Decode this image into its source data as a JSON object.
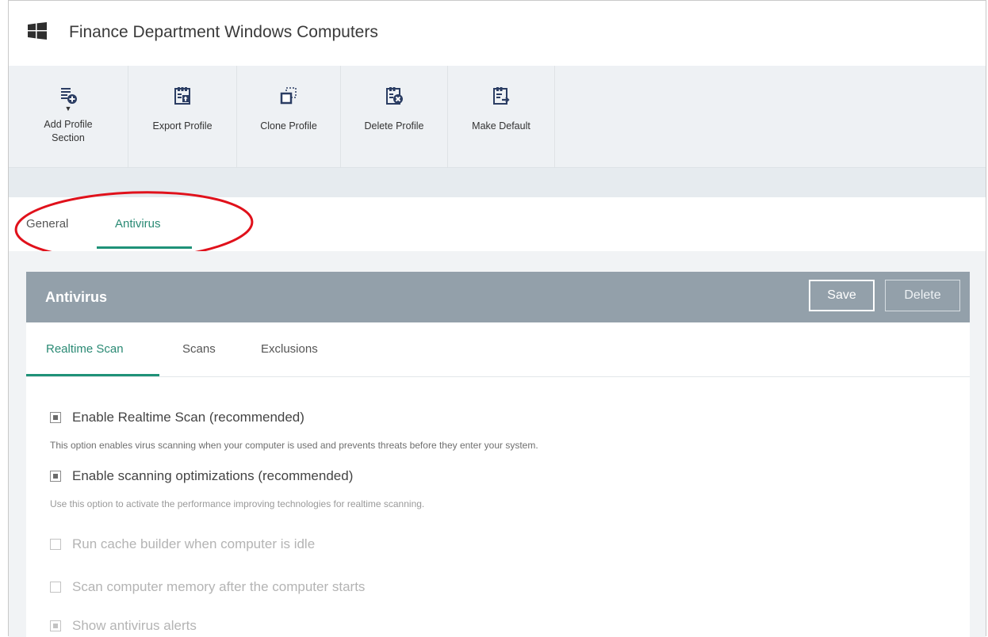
{
  "window": {
    "title": "Finance Department Windows Computers",
    "logo_icon": "windows-logo-icon"
  },
  "toolbar": {
    "items": [
      {
        "label": "Add Profile Section",
        "icon": "add-section-icon",
        "has_dropdown": true
      },
      {
        "label": "Export Profile",
        "icon": "export-icon"
      },
      {
        "label": "Clone Profile",
        "icon": "clone-icon"
      },
      {
        "label": "Delete Profile",
        "icon": "delete-profile-icon"
      },
      {
        "label": "Make Default",
        "icon": "make-default-icon"
      }
    ]
  },
  "top_tabs": [
    {
      "label": "General",
      "active": false
    },
    {
      "label": "Antivirus",
      "active": true
    }
  ],
  "panel": {
    "title": "Antivirus",
    "save_label": "Save",
    "delete_label": "Delete"
  },
  "sub_tabs": [
    {
      "label": "Realtime Scan",
      "active": true
    },
    {
      "label": "Scans",
      "active": false
    },
    {
      "label": "Exclusions",
      "active": false
    }
  ],
  "options": [
    {
      "label": "Enable Realtime Scan (recommended)",
      "checked": true,
      "enabled": true,
      "description": "This option enables virus scanning when your computer is used and prevents threats before they enter your system."
    },
    {
      "label": "Enable scanning optimizations (recommended)",
      "checked": true,
      "enabled": true,
      "description": "Use this option to activate the performance improving technologies for realtime scanning."
    },
    {
      "label": "Run cache builder when computer is idle",
      "checked": false,
      "enabled": false
    },
    {
      "label": "Scan computer memory after the computer starts",
      "checked": false,
      "enabled": false
    },
    {
      "label": "Show antivirus alerts",
      "checked": true,
      "enabled": false
    }
  ],
  "colors": {
    "accent": "#1f9278",
    "panel_header": "#93a0aa",
    "toolbar_bg": "#eef1f4",
    "highlight_circle": "#e0111b"
  }
}
